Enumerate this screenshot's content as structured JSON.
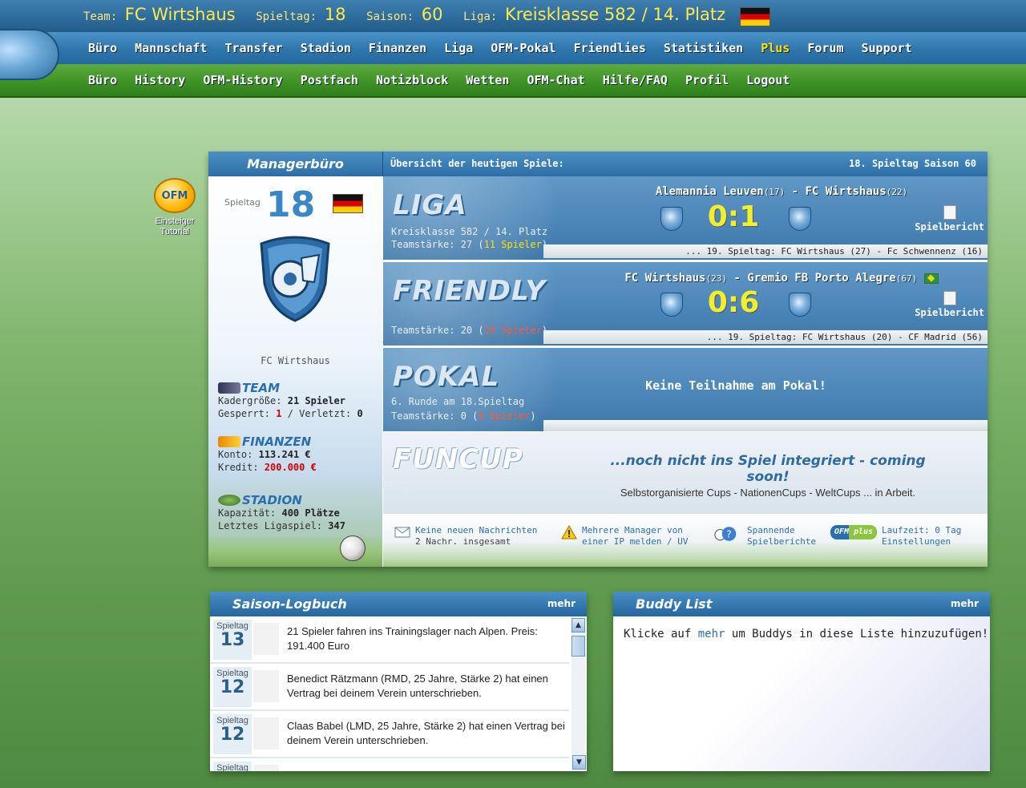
{
  "header": {
    "team_label": "Team:",
    "team": "FC Wirtshaus",
    "spieltag_label": "Spieltag:",
    "spieltag": "18",
    "saison_label": "Saison:",
    "saison": "60",
    "liga_label": "Liga:",
    "liga": "Kreisklasse 582 / 14. Platz"
  },
  "nav_main": [
    "Büro",
    "Mannschaft",
    "Transfer",
    "Stadion",
    "Finanzen",
    "Liga",
    "OFM-Pokal",
    "Friendlies",
    "Statistiken",
    "Plus",
    "Forum",
    "Support"
  ],
  "nav_sub": [
    "Büro",
    "History",
    "OFM-History",
    "Postfach",
    "Notizblock",
    "Wetten",
    "OFM-Chat",
    "Hilfe/FAQ",
    "Profil",
    "Logout"
  ],
  "tutorial": {
    "logo": "OFM",
    "line1": "Einsteiger",
    "line2": "Tutorial"
  },
  "panel": {
    "title": "Managerbüro",
    "overview": "Übersicht der heutigen Spiele:",
    "right": "18. Spieltag Saison 60"
  },
  "sidebar": {
    "spieltag_label": "Spieltag",
    "spieltag": "18",
    "club": "FC Wirtshaus",
    "team_title": "TEAM",
    "kader_label": "Kadergröße:",
    "kader": "21 Spieler",
    "gesperrt_label": "Gesperrt:",
    "gesperrt": "1",
    "verletzt_label": "/ Verletzt:",
    "verletzt": "0",
    "finanzen_title": "FINANZEN",
    "konto_label": "Konto:",
    "konto": "113.241 €",
    "kredit_label": "Kredit:",
    "kredit": "200.000 €",
    "stadion_title": "STADION",
    "kap_label": "Kapazität:",
    "kap": "400 Plätze",
    "letztes_label": "Letztes Ligaspiel:",
    "letztes": "347"
  },
  "liga": {
    "word": "LIGA",
    "sub1": "Kreisklasse 582 / 14. Platz",
    "sub2_pre": "Teamstärke: 27 (",
    "sub2_hl": "11 Spieler",
    "sub2_post": ")",
    "home": "Alemannia Leuven",
    "home_n": "(17)",
    "sep": "-",
    "away": "FC Wirtshaus",
    "away_n": "(22)",
    "score": "0:1",
    "report": "Spielbericht",
    "next": "... 19. Spieltag: FC Wirtshaus (27) - Fc Schwennenz (16)"
  },
  "friendly": {
    "word": "FRIENDLY",
    "sub2_pre": "Teamstärke: 20 (",
    "sub2_hl": "10 Spieler",
    "sub2_post": ")",
    "home": "FC Wirtshaus",
    "home_n": "(23)",
    "sep": "-",
    "away": "Gremio FB Porto Alegre",
    "away_n": "(67)",
    "score": "0:6",
    "report": "Spielbericht",
    "next": "... 19. Spieltag: FC Wirtshaus (20) - CF Madrid (56)"
  },
  "pokal": {
    "word": "POKAL",
    "sub1": "6. Runde am 18.Spieltag",
    "sub2_pre": "Teamstärke: 0 (",
    "sub2_hl": "0 Spieler",
    "sub2_post": ")",
    "msg": "Keine Teilnahme am Pokal!"
  },
  "funcup": {
    "word": "FUNCUP",
    "msg1": "...noch nicht ins Spiel integriert - coming soon!",
    "msg2": "Selbstorganisierte Cups - NationenCups - WeltCups ... in Arbeit."
  },
  "footer": {
    "msg_a": "Keine neuen Nachrichten",
    "msg_b": "2 Nachr. insgesamt",
    "ip_a": "Mehrere Manager von",
    "ip_b": "einer IP melden / UV",
    "rep_a": "Spannende",
    "rep_b": "Spielberichte",
    "plus_logo": "OFM plus",
    "plus_a": "Laufzeit: 0 Tag",
    "plus_b": "Einstellungen"
  },
  "logbook": {
    "title": "Saison-Logbuch",
    "more": "mehr",
    "items": [
      {
        "label": "Spieltag",
        "day": "13",
        "text": "21 Spieler fahren ins Trainingslager nach Alpen. Preis: 191.400 Euro"
      },
      {
        "label": "Spieltag",
        "day": "12",
        "text": "Benedict Rätzmann (RMD, 25 Jahre, Stärke 2) hat einen Vertrag bei deinem Verein unterschrieben."
      },
      {
        "label": "Spieltag",
        "day": "12",
        "text": "Claas Babel (LMD, 25 Jahre, Stärke 2) hat einen Vertrag bei deinem Verein unterschrieben."
      },
      {
        "label": "Spieltag",
        "day": "",
        "text": ""
      }
    ]
  },
  "buddy": {
    "title": "Buddy List",
    "more": "mehr",
    "text_pre": "Klicke auf",
    "text_link": "mehr",
    "text_post": "um Buddys in diese Liste hinzuzufügen!"
  },
  "colors": {
    "accent_yellow": "#ffe200",
    "nav_blue": "#2d76ac",
    "nav_green": "#3f9426",
    "score_yellow": "#f3ee2b",
    "red": "#d10000"
  }
}
